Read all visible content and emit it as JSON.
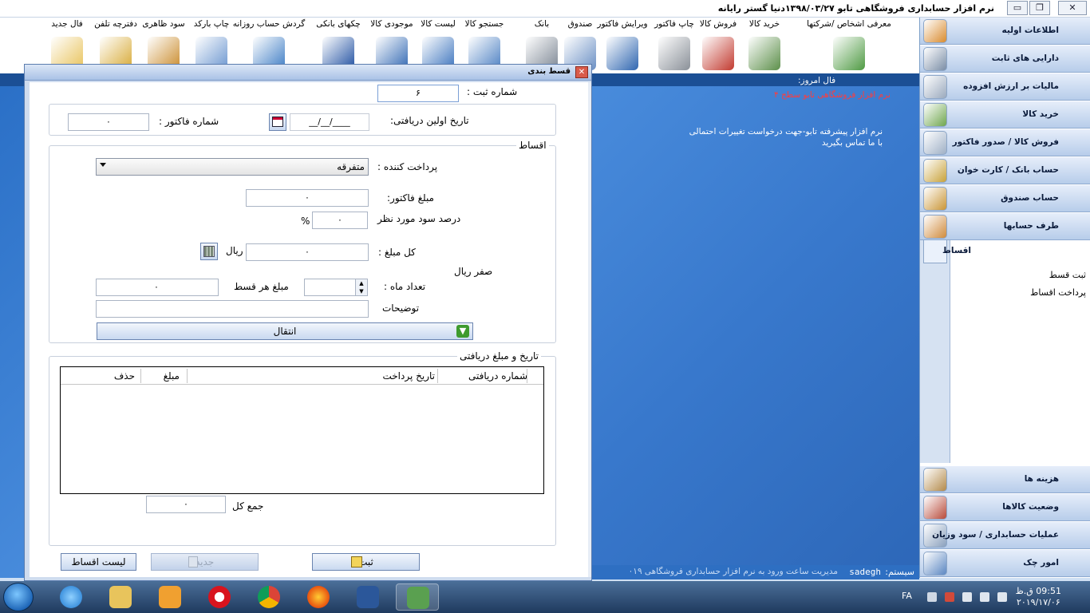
{
  "window": {
    "title": "نرم افزار حسابداری فروشگاهی تابو   ۱۳۹۸/۰۳/۲۷دنیا گستر رایانه",
    "minimize": "▭",
    "restore": "❐",
    "close": "✕"
  },
  "toolbar": {
    "items": [
      {
        "label": "معرفی اشخاص /شرکتها",
        "icon": "person-add-icon",
        "color": "#4f9a43"
      },
      {
        "label": "خرید کالا",
        "icon": "trash-bin-icon",
        "color": "#5c8f4a"
      },
      {
        "label": "فروش کالا",
        "icon": "clipboard-check-icon",
        "color": "#c23a2f"
      },
      {
        "label": "چاپ فاکتور",
        "icon": "printer-icon",
        "color": "#8a9098"
      },
      {
        "label": "ویرایش فاکتور",
        "icon": "book-edit-icon",
        "color": "#2f66b0"
      },
      {
        "label": "صندوق",
        "icon": "cash-box-icon",
        "color": "#6a8fc4"
      },
      {
        "label": "بانک",
        "icon": "document-icon",
        "color": "#7d8794"
      },
      {
        "label": "جستجو کالا",
        "icon": "calendar-icon",
        "color": "#4b7fc2"
      },
      {
        "label": "لیست کالا",
        "icon": "list-icon",
        "color": "#3b73bd"
      },
      {
        "label": "موجودی کالا",
        "icon": "chart-icon",
        "color": "#3067b2"
      },
      {
        "label": "چکهای بانکی",
        "icon": "forward-arrows-icon",
        "color": "#1d4ea0"
      },
      {
        "label": "گردش حساب روزانه",
        "icon": "help-book-icon",
        "color": "#3d7cc4"
      },
      {
        "label": "چاپ بارکد",
        "icon": "camera-search-icon",
        "color": "#6a95cf"
      },
      {
        "label": "سود ظاهری",
        "icon": "books-icon",
        "color": "#c98a2a"
      },
      {
        "label": "دفترچه تلفن",
        "icon": "contact-info-icon",
        "color": "#d7a934"
      },
      {
        "label": "فال جدید",
        "icon": "lightbulb-icon",
        "color": "#e8c25a"
      }
    ]
  },
  "sidebar": {
    "items": [
      {
        "label": "اطلاعات اولیه",
        "icon": "users-icon",
        "color": "#d98b2f"
      },
      {
        "label": "دارایی های ثابت",
        "icon": "register-icon",
        "color": "#7a8da6"
      },
      {
        "label": "مالیات بر ارزش افزوده",
        "icon": "calculator-icon",
        "color": "#9aa9bd"
      },
      {
        "label": "خرید کالا",
        "icon": "cart-add-icon",
        "color": "#6fa64e"
      },
      {
        "label": "فروش کالا  /  صدور فاکتور",
        "icon": "cart-pen-icon",
        "color": "#9fb0c6"
      },
      {
        "label": "حساب بانک  /  کارت خوان",
        "icon": "card-reader-icon",
        "color": "#c8a23a"
      },
      {
        "label": "حساب صندوق",
        "icon": "money-bag-icon",
        "color": "#c99536"
      },
      {
        "label": "طرف حسابها",
        "icon": "people-icon",
        "color": "#d08b3c"
      }
    ],
    "active": {
      "label": "اقساط",
      "icon": "table-icon",
      "sub_items": [
        "ثبت قسط",
        "پرداخت اقساط"
      ]
    },
    "bottom_items": [
      {
        "label": "هزینه ها",
        "icon": "cup-icon",
        "color": "#b38a4a"
      },
      {
        "label": "وضعیت کالاها",
        "icon": "box-icon",
        "color": "#b84a3a"
      },
      {
        "label": "عملیات حسابداری  /  سود وزیان",
        "icon": "ledger-icon",
        "color": "#8aa0bd"
      },
      {
        "label": "امور چک",
        "icon": "check-pen-icon",
        "color": "#5b87c2"
      }
    ]
  },
  "background": {
    "info_title": "فال امروز:",
    "info_red": "نرم افزار فروشگاهی تابو سطح ۴",
    "info_line1": "نرم افزار پیشرفته تابو-جهت درخواست تغییرات احتمالی",
    "info_line2": "با ما تماس بگیرید",
    "status_system_label": "سیستم:",
    "status_user": "sadegh",
    "status_text": "مدیریت ساعت ورود به  نرم افزار حسابداری فروشگاهی  ۰۱۹"
  },
  "dialog": {
    "title": "قسط بندی",
    "close": "✕",
    "reg_number_label": "شماره ثبت :",
    "reg_number_value": "۶",
    "first_receipt_date_label": "تاریخ اولین دریافتی:",
    "first_receipt_date_value": "__/__/____",
    "invoice_number_label": "شماره فاکتور :",
    "invoice_number_value": "۰",
    "installments_group": "اقساط",
    "payer_label": "پرداخت کننده :",
    "payer_value": "متفرقه",
    "invoice_amount_label": "مبلغ فاکتور:",
    "invoice_amount_value": "۰",
    "profit_percent_label": "درصد سود مورد نظر",
    "profit_percent_value": "۰",
    "percent_sign": "%",
    "total_amount_label": "کل مبلغ :",
    "total_amount_value": "۰",
    "rial_label": "ریال",
    "amount_in_words": "صفر ریال",
    "months_label": "تعداد ماه :",
    "months_value": "",
    "installment_amount_label": "مبلغ هر قسط",
    "installment_amount_value": "۰",
    "description_label": "توضیحات",
    "description_value": "",
    "transfer_button": "انتقال",
    "schedule_group": "تاریخ و مبلغ دریافتی",
    "grid_headers": [
      "شماره دریافتی",
      "تاریخ پرداخت",
      "مبلغ",
      "حذف"
    ],
    "grid_rows": [],
    "grand_total_label": "جمع کل",
    "grand_total_value": "۰",
    "save_button": "ثبت",
    "new_button": "جدید",
    "list_button": "لیست اقساط"
  },
  "taskbar": {
    "lang": "FA",
    "time": "09:51 ق.ظ",
    "date": "۲۰۱۹/۱۷/۰۶"
  }
}
